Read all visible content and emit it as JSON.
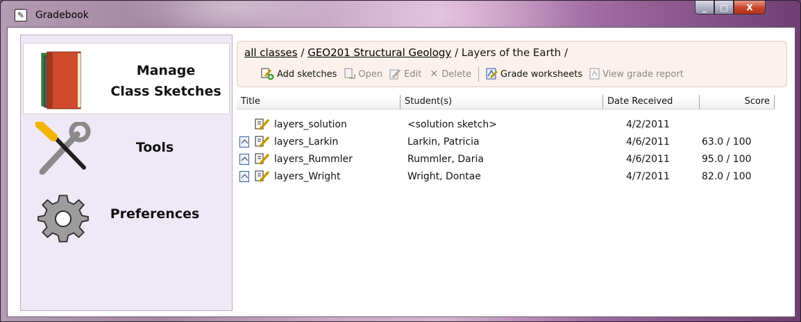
{
  "window": {
    "title": "Gradebook",
    "buttons": {
      "minimize": "_",
      "maximize": "□",
      "close": "X"
    }
  },
  "nav": {
    "items": [
      {
        "label_line1": "Manage",
        "label_line2": "Class Sketches",
        "icon": "books-icon",
        "selected": true
      },
      {
        "label_line1": "Tools",
        "label_line2": "",
        "icon": "tools-icon",
        "selected": false
      },
      {
        "label_line1": "Preferences",
        "label_line2": "",
        "icon": "gear-icon",
        "selected": false
      }
    ]
  },
  "breadcrumb": {
    "crumbs": [
      "all classes",
      "GEO201 Structural Geology",
      "Layers of the Earth"
    ],
    "separator": "/"
  },
  "toolbar": {
    "add_sketches": "Add sketches",
    "open": "Open",
    "edit": "Edit",
    "delete": "Delete",
    "grade_worksheets": "Grade worksheets",
    "view_grade_report": "View grade report"
  },
  "table": {
    "columns": [
      "Title",
      "Student(s)",
      "Date Received",
      "Score"
    ],
    "rows": [
      {
        "title": "layers_solution",
        "student": "<solution sketch>",
        "date": "4/2/2011",
        "score": "",
        "has_doc_icon": false
      },
      {
        "title": "layers_Larkin",
        "student": "Larkin, Patricia",
        "date": "4/6/2011",
        "score": "63.0 / 100",
        "has_doc_icon": true
      },
      {
        "title": "layers_Rummler",
        "student": "Rummler, Daria",
        "date": "4/6/2011",
        "score": "95.0 / 100",
        "has_doc_icon": true
      },
      {
        "title": "layers_Wright",
        "student": "Wright, Dontae",
        "date": "4/7/2011",
        "score": "82.0 / 100",
        "has_doc_icon": true
      }
    ]
  },
  "colors": {
    "nav_bg": "#efe8f6",
    "toolbar_bg": "#fcf1ec",
    "close_button": "#c8432a"
  }
}
